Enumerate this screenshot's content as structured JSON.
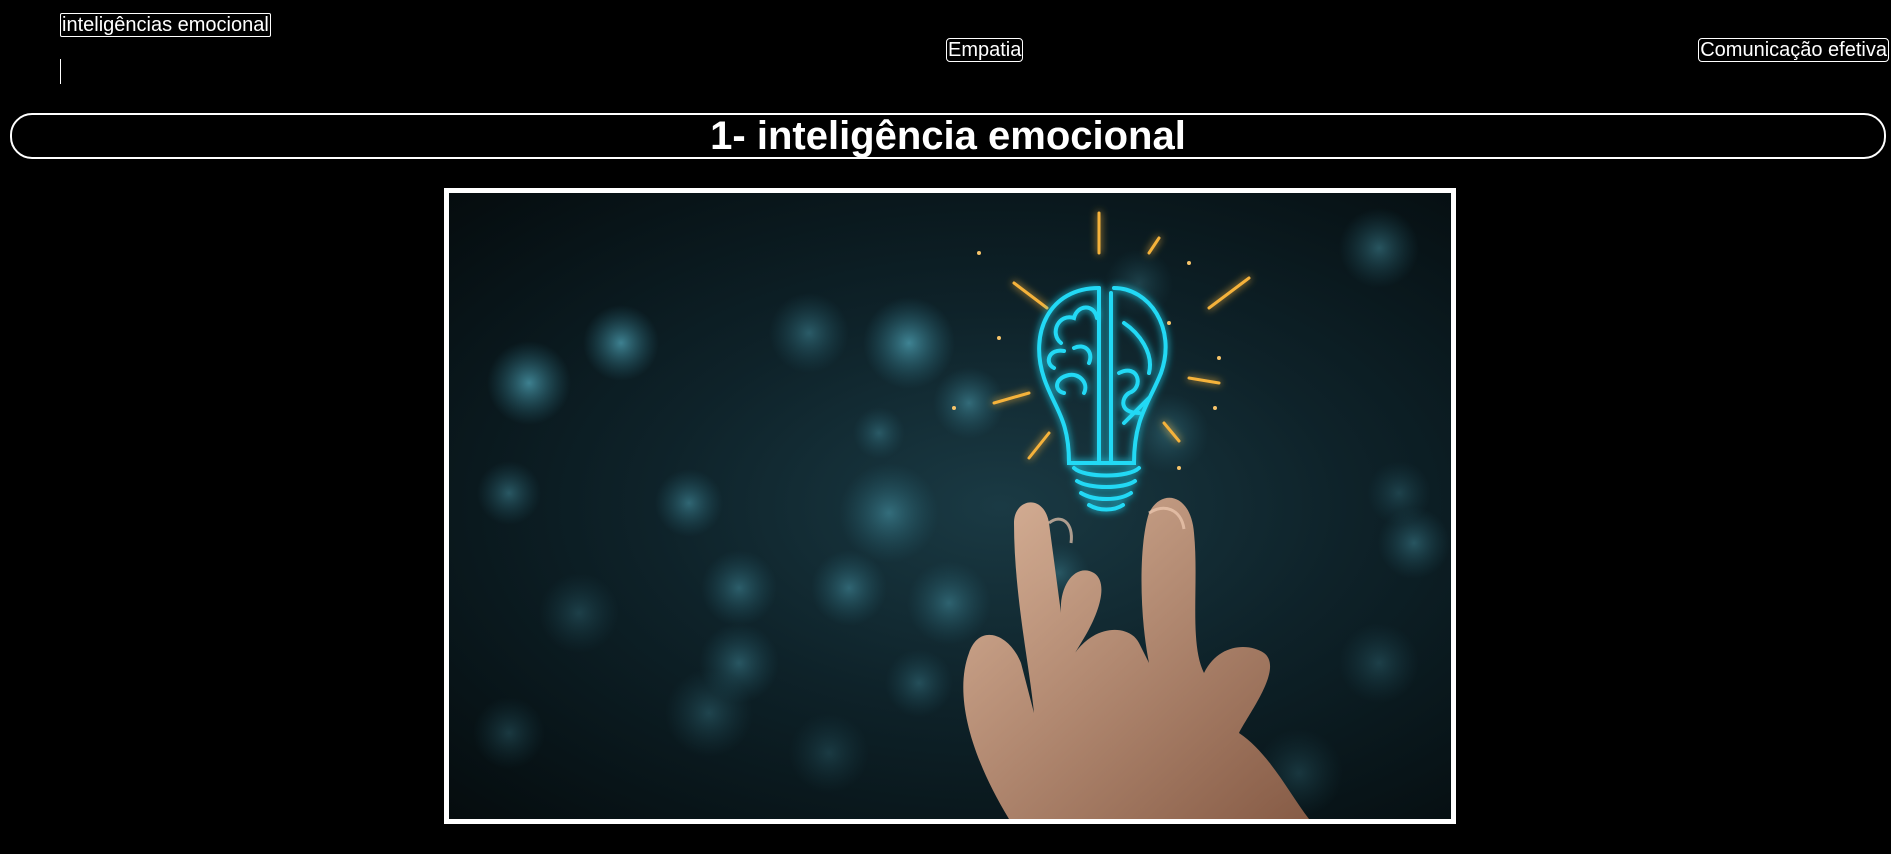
{
  "nav": {
    "links": [
      {
        "label": "inteligências emocional"
      },
      {
        "label": "Empatia"
      },
      {
        "label": "Comunicação efetiva"
      }
    ]
  },
  "main": {
    "heading": "1- inteligência emocional"
  },
  "image": {
    "subject": "hand-with-glowing-brain-lightbulb",
    "colors": {
      "background": "#0e2229",
      "bokeh": "#3c8fa3",
      "glow": "#22d9f5",
      "rays": "#f5b23a",
      "skin": "#c99a7a"
    }
  }
}
